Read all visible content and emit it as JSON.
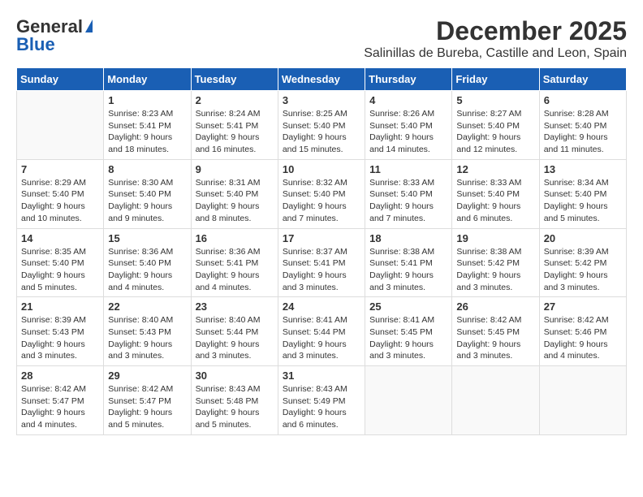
{
  "header": {
    "logo_general": "General",
    "logo_blue": "Blue",
    "month_title": "December 2025",
    "subtitle": "Salinillas de Bureba, Castille and Leon, Spain"
  },
  "days_of_week": [
    "Sunday",
    "Monday",
    "Tuesday",
    "Wednesday",
    "Thursday",
    "Friday",
    "Saturday"
  ],
  "weeks": [
    [
      {
        "day": "",
        "sunrise": "",
        "sunset": "",
        "daylight": ""
      },
      {
        "day": "1",
        "sunrise": "Sunrise: 8:23 AM",
        "sunset": "Sunset: 5:41 PM",
        "daylight": "Daylight: 9 hours and 18 minutes."
      },
      {
        "day": "2",
        "sunrise": "Sunrise: 8:24 AM",
        "sunset": "Sunset: 5:41 PM",
        "daylight": "Daylight: 9 hours and 16 minutes."
      },
      {
        "day": "3",
        "sunrise": "Sunrise: 8:25 AM",
        "sunset": "Sunset: 5:40 PM",
        "daylight": "Daylight: 9 hours and 15 minutes."
      },
      {
        "day": "4",
        "sunrise": "Sunrise: 8:26 AM",
        "sunset": "Sunset: 5:40 PM",
        "daylight": "Daylight: 9 hours and 14 minutes."
      },
      {
        "day": "5",
        "sunrise": "Sunrise: 8:27 AM",
        "sunset": "Sunset: 5:40 PM",
        "daylight": "Daylight: 9 hours and 12 minutes."
      },
      {
        "day": "6",
        "sunrise": "Sunrise: 8:28 AM",
        "sunset": "Sunset: 5:40 PM",
        "daylight": "Daylight: 9 hours and 11 minutes."
      }
    ],
    [
      {
        "day": "7",
        "sunrise": "Sunrise: 8:29 AM",
        "sunset": "Sunset: 5:40 PM",
        "daylight": "Daylight: 9 hours and 10 minutes."
      },
      {
        "day": "8",
        "sunrise": "Sunrise: 8:30 AM",
        "sunset": "Sunset: 5:40 PM",
        "daylight": "Daylight: 9 hours and 9 minutes."
      },
      {
        "day": "9",
        "sunrise": "Sunrise: 8:31 AM",
        "sunset": "Sunset: 5:40 PM",
        "daylight": "Daylight: 9 hours and 8 minutes."
      },
      {
        "day": "10",
        "sunrise": "Sunrise: 8:32 AM",
        "sunset": "Sunset: 5:40 PM",
        "daylight": "Daylight: 9 hours and 7 minutes."
      },
      {
        "day": "11",
        "sunrise": "Sunrise: 8:33 AM",
        "sunset": "Sunset: 5:40 PM",
        "daylight": "Daylight: 9 hours and 7 minutes."
      },
      {
        "day": "12",
        "sunrise": "Sunrise: 8:33 AM",
        "sunset": "Sunset: 5:40 PM",
        "daylight": "Daylight: 9 hours and 6 minutes."
      },
      {
        "day": "13",
        "sunrise": "Sunrise: 8:34 AM",
        "sunset": "Sunset: 5:40 PM",
        "daylight": "Daylight: 9 hours and 5 minutes."
      }
    ],
    [
      {
        "day": "14",
        "sunrise": "Sunrise: 8:35 AM",
        "sunset": "Sunset: 5:40 PM",
        "daylight": "Daylight: 9 hours and 5 minutes."
      },
      {
        "day": "15",
        "sunrise": "Sunrise: 8:36 AM",
        "sunset": "Sunset: 5:40 PM",
        "daylight": "Daylight: 9 hours and 4 minutes."
      },
      {
        "day": "16",
        "sunrise": "Sunrise: 8:36 AM",
        "sunset": "Sunset: 5:41 PM",
        "daylight": "Daylight: 9 hours and 4 minutes."
      },
      {
        "day": "17",
        "sunrise": "Sunrise: 8:37 AM",
        "sunset": "Sunset: 5:41 PM",
        "daylight": "Daylight: 9 hours and 3 minutes."
      },
      {
        "day": "18",
        "sunrise": "Sunrise: 8:38 AM",
        "sunset": "Sunset: 5:41 PM",
        "daylight": "Daylight: 9 hours and 3 minutes."
      },
      {
        "day": "19",
        "sunrise": "Sunrise: 8:38 AM",
        "sunset": "Sunset: 5:42 PM",
        "daylight": "Daylight: 9 hours and 3 minutes."
      },
      {
        "day": "20",
        "sunrise": "Sunrise: 8:39 AM",
        "sunset": "Sunset: 5:42 PM",
        "daylight": "Daylight: 9 hours and 3 minutes."
      }
    ],
    [
      {
        "day": "21",
        "sunrise": "Sunrise: 8:39 AM",
        "sunset": "Sunset: 5:43 PM",
        "daylight": "Daylight: 9 hours and 3 minutes."
      },
      {
        "day": "22",
        "sunrise": "Sunrise: 8:40 AM",
        "sunset": "Sunset: 5:43 PM",
        "daylight": "Daylight: 9 hours and 3 minutes."
      },
      {
        "day": "23",
        "sunrise": "Sunrise: 8:40 AM",
        "sunset": "Sunset: 5:44 PM",
        "daylight": "Daylight: 9 hours and 3 minutes."
      },
      {
        "day": "24",
        "sunrise": "Sunrise: 8:41 AM",
        "sunset": "Sunset: 5:44 PM",
        "daylight": "Daylight: 9 hours and 3 minutes."
      },
      {
        "day": "25",
        "sunrise": "Sunrise: 8:41 AM",
        "sunset": "Sunset: 5:45 PM",
        "daylight": "Daylight: 9 hours and 3 minutes."
      },
      {
        "day": "26",
        "sunrise": "Sunrise: 8:42 AM",
        "sunset": "Sunset: 5:45 PM",
        "daylight": "Daylight: 9 hours and 3 minutes."
      },
      {
        "day": "27",
        "sunrise": "Sunrise: 8:42 AM",
        "sunset": "Sunset: 5:46 PM",
        "daylight": "Daylight: 9 hours and 4 minutes."
      }
    ],
    [
      {
        "day": "28",
        "sunrise": "Sunrise: 8:42 AM",
        "sunset": "Sunset: 5:47 PM",
        "daylight": "Daylight: 9 hours and 4 minutes."
      },
      {
        "day": "29",
        "sunrise": "Sunrise: 8:42 AM",
        "sunset": "Sunset: 5:47 PM",
        "daylight": "Daylight: 9 hours and 5 minutes."
      },
      {
        "day": "30",
        "sunrise": "Sunrise: 8:43 AM",
        "sunset": "Sunset: 5:48 PM",
        "daylight": "Daylight: 9 hours and 5 minutes."
      },
      {
        "day": "31",
        "sunrise": "Sunrise: 8:43 AM",
        "sunset": "Sunset: 5:49 PM",
        "daylight": "Daylight: 9 hours and 6 minutes."
      },
      {
        "day": "",
        "sunrise": "",
        "sunset": "",
        "daylight": ""
      },
      {
        "day": "",
        "sunrise": "",
        "sunset": "",
        "daylight": ""
      },
      {
        "day": "",
        "sunrise": "",
        "sunset": "",
        "daylight": ""
      }
    ]
  ]
}
